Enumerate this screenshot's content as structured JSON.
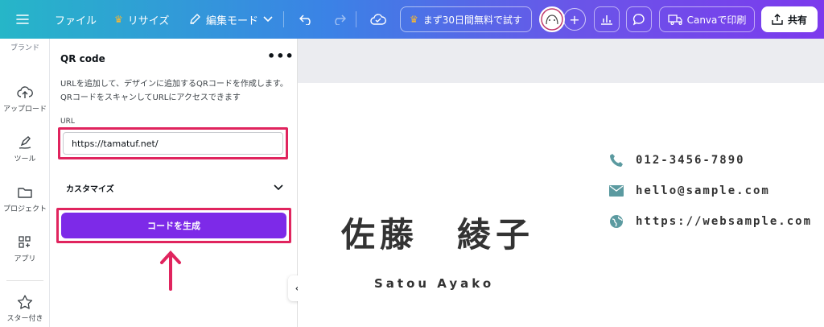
{
  "topbar": {
    "file": "ファイル",
    "resize": "リサイズ",
    "edit_mode": "編集モード",
    "trial": "まず30日間無料で試す",
    "print": "Canvaで印刷",
    "share": "共有"
  },
  "rail": {
    "items": [
      {
        "label": "ブランド"
      },
      {
        "label": "アップロード"
      },
      {
        "label": "ツール"
      },
      {
        "label": "プロジェクト"
      },
      {
        "label": "アプリ"
      },
      {
        "label": "スター付き"
      }
    ]
  },
  "panel": {
    "title": "QR code",
    "description": "URLを追加して、デザインに追加するQRコードを作成します。QRコードをスキャンしてURLにアクセスできます",
    "url_label": "URL",
    "url_value": "https://tamatuf.net/",
    "customize": "カスタマイズ",
    "generate": "コードを生成"
  },
  "card": {
    "name_jp": "佐藤　綾子",
    "name_en": "Satou Ayako",
    "phone": "012-3456-7890",
    "email": "hello@sample.com",
    "web": "https://websample.com"
  },
  "colors": {
    "accent": "#7d2ae8",
    "highlight": "#e0245e",
    "icon_teal": "#5b9aa0"
  }
}
